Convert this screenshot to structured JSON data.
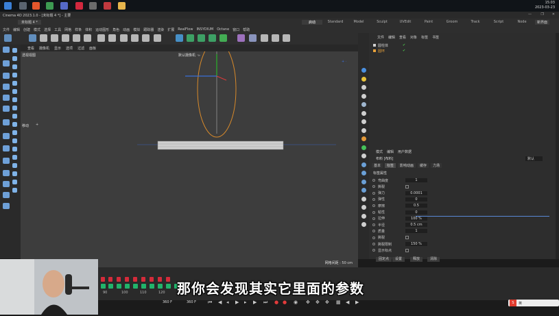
{
  "taskbar": {
    "time": "15:03",
    "date": "2023-03-23"
  },
  "titlebar": {
    "title": "Cinema 4D 2023.1.0 - [未标题 4 *] - 主要",
    "tab": "未标题 4 *"
  },
  "menu": [
    "文件",
    "编辑",
    "创建",
    "模式",
    "选择",
    "工具",
    "网格",
    "样条",
    "体积",
    "运动图形",
    "角色",
    "动画",
    "模拟",
    "跟踪器",
    "渲染",
    "扩展",
    "RealFlow",
    "INSYDIUM",
    "Octane",
    "窗口",
    "帮助"
  ],
  "layout_tabs": [
    "启动",
    "Standard",
    "Model",
    "Sculpt",
    "UVEdit",
    "Paint",
    "Groom",
    "Track",
    "Script",
    "Node"
  ],
  "layout_active": "启动",
  "new_layout": "新界面",
  "viewport": {
    "menu": [
      "查看",
      "摄像机",
      "显示",
      "选项",
      "过滤",
      "面板"
    ],
    "label": "透视视图",
    "camera": "默认摄像机 ◦▹",
    "move_label": "移动",
    "grid": "网格间距 : 50 cm"
  },
  "object_manager": {
    "menu": [
      "文件",
      "编辑",
      "查看",
      "对象",
      "标签",
      "书签"
    ],
    "objects": [
      {
        "name": "圆柱体",
        "color": "#cfcfcf"
      },
      {
        "name": "圆环",
        "color": "#e8a23a"
      }
    ]
  },
  "attributes": {
    "menu": [
      "模式",
      "编辑",
      "用户数据"
    ],
    "object": "布料 [布料]",
    "preset": "默认",
    "tabs": [
      "基本",
      "标签",
      "影响动画",
      "缓存",
      "力场"
    ],
    "active_tab": "标签",
    "section": "标签属性",
    "rows": [
      {
        "label": "弯曲度",
        "value": "1"
      },
      {
        "label": "撕裂",
        "value": ""
      },
      {
        "label": "弹力",
        "value": "0.0001"
      },
      {
        "label": "弹性",
        "value": "0"
      },
      {
        "label": "摩擦",
        "value": "0.5"
      },
      {
        "label": "粘性",
        "value": "0"
      },
      {
        "label": "拉伸",
        "value": "100 %"
      },
      {
        "label": "半径",
        "value": "0.5 cm"
      },
      {
        "label": "质量",
        "value": "1"
      },
      {
        "label": "撕裂",
        "value": ""
      },
      {
        "label": "撕裂限制",
        "value": "150 %"
      },
      {
        "label": "显示标点",
        "value": ""
      }
    ],
    "buttons": [
      "固定点",
      "设置",
      "释放",
      "清除"
    ]
  },
  "timeline": {
    "ticks": [
      "90",
      "100",
      "110",
      "120",
      "130",
      "140"
    ],
    "start_frame": "360 F",
    "end_frame": "360 F"
  },
  "subtitle": "那你会发现其实它里面的参数",
  "ime": "英"
}
